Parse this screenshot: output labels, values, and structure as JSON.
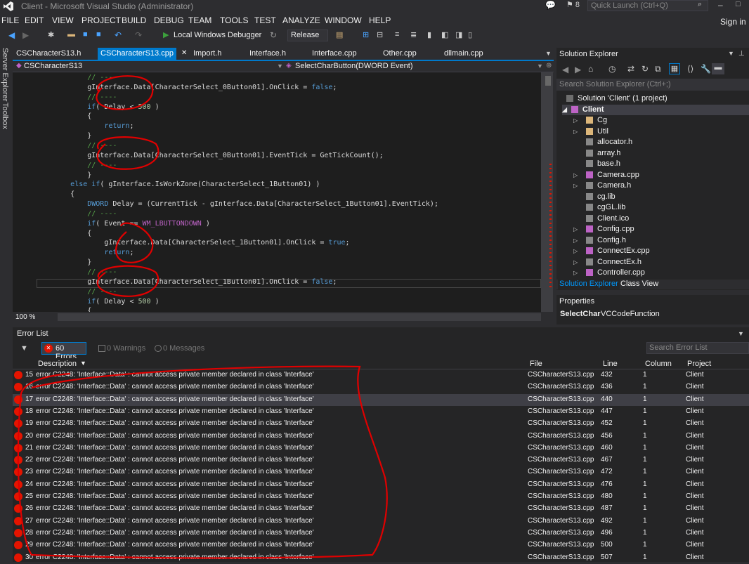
{
  "window": {
    "title": "Client - Microsoft Visual Studio (Administrator)",
    "quick_launch_placeholder": "Quick Launch (Ctrl+Q)",
    "notifications": "8"
  },
  "menu": [
    "FILE",
    "EDIT",
    "VIEW",
    "PROJECT",
    "BUILD",
    "DEBUG",
    "TEAM",
    "TOOLS",
    "TEST",
    "ANALYZE",
    "WINDOW",
    "HELP"
  ],
  "signin": "Sign in",
  "toolbar": {
    "run_label": "Local Windows Debugger",
    "config": "Release"
  },
  "left_strip": {
    "server_explorer": "Server Explorer",
    "toolbox": "Toolbox"
  },
  "tabs": [
    "CSCharacterS13.h",
    "CSCharacterS13.cpp",
    "Import.h",
    "Interface.h",
    "Interface.cpp",
    "Other.cpp",
    "dllmain.cpp"
  ],
  "navbar": {
    "scope": "CSCharacterS13",
    "member": "SelectCharButton(DWORD Event)"
  },
  "editor": {
    "zoom": "100 %"
  },
  "solution_explorer": {
    "title": "Solution Explorer",
    "search_placeholder": "Search Solution Explorer (Ctrl+;)",
    "solution": "Solution 'Client' (1 project)",
    "project": "Client",
    "items": [
      "Cg",
      "Util",
      "allocator.h",
      "array.h",
      "base.h",
      "Camera.cpp",
      "Camera.h",
      "cg.lib",
      "cgGL.lib",
      "Client.ico",
      "Config.cpp",
      "Config.h",
      "ConnectEx.cpp",
      "ConnectEx.h",
      "Controller.cpp"
    ],
    "tab_active": "Solution Explorer",
    "tab_other": "Class View"
  },
  "properties": {
    "title": "Properties",
    "name": "SelectChar",
    "type": "VCCodeFunction"
  },
  "error_list": {
    "title": "Error List",
    "errors_label": "60 Errors",
    "warnings_label": "0 Warnings",
    "messages_label": "0 Messages",
    "search_placeholder": "Search Error List",
    "columns": [
      "Description",
      "File",
      "Line",
      "Column",
      "Project"
    ],
    "rows": [
      {
        "n": "15",
        "desc": "error C2248: 'Interface::Data' : cannot access private member declared in class 'Interface'",
        "file": "CSCharacterS13.cpp",
        "line": "432",
        "col": "1",
        "proj": "Client"
      },
      {
        "n": "16",
        "desc": "error C2248: 'Interface::Data' : cannot access private member declared in class 'Interface'",
        "file": "CSCharacterS13.cpp",
        "line": "436",
        "col": "1",
        "proj": "Client"
      },
      {
        "n": "17",
        "desc": "error C2248: 'Interface::Data' : cannot access private member declared in class 'Interface'",
        "file": "CSCharacterS13.cpp",
        "line": "440",
        "col": "1",
        "proj": "Client"
      },
      {
        "n": "18",
        "desc": "error C2248: 'Interface::Data' : cannot access private member declared in class 'Interface'",
        "file": "CSCharacterS13.cpp",
        "line": "447",
        "col": "1",
        "proj": "Client"
      },
      {
        "n": "19",
        "desc": "error C2248: 'Interface::Data' : cannot access private member declared in class 'Interface'",
        "file": "CSCharacterS13.cpp",
        "line": "452",
        "col": "1",
        "proj": "Client"
      },
      {
        "n": "20",
        "desc": "error C2248: 'Interface::Data' : cannot access private member declared in class 'Interface'",
        "file": "CSCharacterS13.cpp",
        "line": "456",
        "col": "1",
        "proj": "Client"
      },
      {
        "n": "21",
        "desc": "error C2248: 'Interface::Data' : cannot access private member declared in class 'Interface'",
        "file": "CSCharacterS13.cpp",
        "line": "460",
        "col": "1",
        "proj": "Client"
      },
      {
        "n": "22",
        "desc": "error C2248: 'Interface::Data' : cannot access private member declared in class 'Interface'",
        "file": "CSCharacterS13.cpp",
        "line": "467",
        "col": "1",
        "proj": "Client"
      },
      {
        "n": "23",
        "desc": "error C2248: 'Interface::Data' : cannot access private member declared in class 'Interface'",
        "file": "CSCharacterS13.cpp",
        "line": "472",
        "col": "1",
        "proj": "Client"
      },
      {
        "n": "24",
        "desc": "error C2248: 'Interface::Data' : cannot access private member declared in class 'Interface'",
        "file": "CSCharacterS13.cpp",
        "line": "476",
        "col": "1",
        "proj": "Client"
      },
      {
        "n": "25",
        "desc": "error C2248: 'Interface::Data' : cannot access private member declared in class 'Interface'",
        "file": "CSCharacterS13.cpp",
        "line": "480",
        "col": "1",
        "proj": "Client"
      },
      {
        "n": "26",
        "desc": "error C2248: 'Interface::Data' : cannot access private member declared in class 'Interface'",
        "file": "CSCharacterS13.cpp",
        "line": "487",
        "col": "1",
        "proj": "Client"
      },
      {
        "n": "27",
        "desc": "error C2248: 'Interface::Data' : cannot access private member declared in class 'Interface'",
        "file": "CSCharacterS13.cpp",
        "line": "492",
        "col": "1",
        "proj": "Client"
      },
      {
        "n": "28",
        "desc": "error C2248: 'Interface::Data' : cannot access private member declared in class 'Interface'",
        "file": "CSCharacterS13.cpp",
        "line": "496",
        "col": "1",
        "proj": "Client"
      },
      {
        "n": "29",
        "desc": "error C2248: 'Interface::Data' : cannot access private member declared in class 'Interface'",
        "file": "CSCharacterS13.cpp",
        "line": "500",
        "col": "1",
        "proj": "Client"
      },
      {
        "n": "30",
        "desc": "error C2248: 'Interface::Data' : cannot access private member declared in class 'Interface'",
        "file": "CSCharacterS13.cpp",
        "line": "507",
        "col": "1",
        "proj": "Client"
      }
    ]
  },
  "code_lines": [
    "            // ----",
    "            gInterface.Data[CharacterSelect_0Button01].OnClick = false;",
    "            // ----",
    "            if( Delay < 500 )",
    "            {",
    "                return;",
    "            }",
    "            // ----",
    "            gInterface.Data[CharacterSelect_0Button01].EventTick = GetTickCount();",
    "            // ----",
    "            }",
    "        else if( gInterface.IsWorkZone(CharacterSelect_1Button01) )",
    "        {",
    "            DWORD Delay = (CurrentTick - gInterface.Data[CharacterSelect_1Button01].EventTick);",
    "            // ----",
    "            if( Event == WM_LBUTTONDOWN )",
    "            {",
    "                gInterface.Data[CharacterSelect_1Button01].OnClick = true;",
    "                return;",
    "            }",
    "            // ----",
    "            gInterface.Data[CharacterSelect_1Button01].OnClick = false;",
    "            // ----",
    "            if( Delay < 500 )",
    "            {"
  ],
  "colors": {
    "accent": "#007acc",
    "error": "#e51400",
    "annotation": "#e00000"
  }
}
